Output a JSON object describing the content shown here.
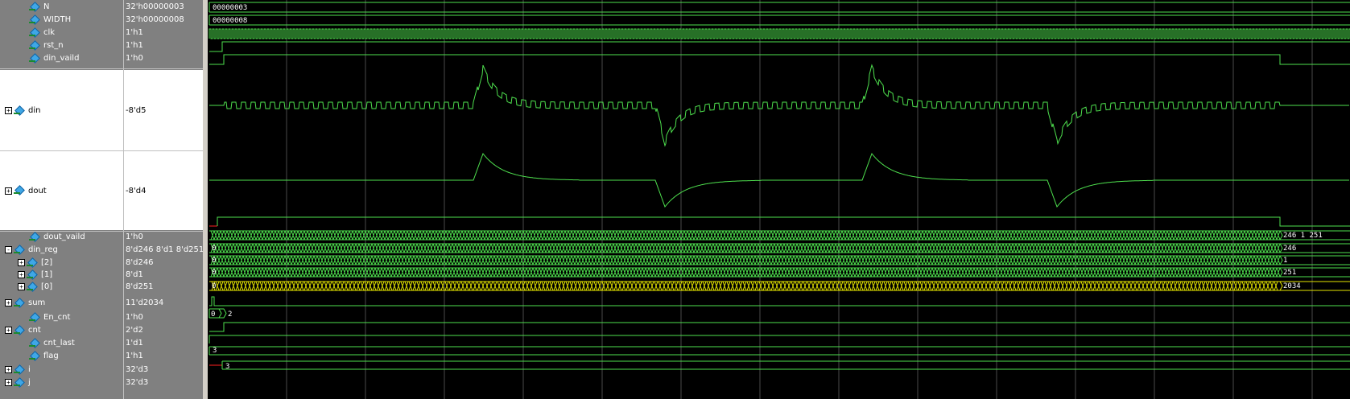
{
  "signals": [
    {
      "name": "N",
      "value": "32'h00000003",
      "indent": 1,
      "expand": "",
      "wave_label": "00000003"
    },
    {
      "name": "WIDTH",
      "value": "32'h00000008",
      "indent": 1,
      "expand": "",
      "wave_label": "00000008"
    },
    {
      "name": "clk",
      "value": "1'h1",
      "indent": 1,
      "expand": "",
      "wave_label": ""
    },
    {
      "name": "rst_n",
      "value": "1'h1",
      "indent": 1,
      "expand": "",
      "wave_label": ""
    },
    {
      "name": "din_vaild",
      "value": "1'h0",
      "indent": 1,
      "expand": "",
      "wave_label": ""
    },
    {
      "name": "din",
      "value": "-8'd5",
      "indent": 0,
      "expand": "+",
      "wave_label": ""
    },
    {
      "name": "dout",
      "value": "-8'd4",
      "indent": 0,
      "expand": "+",
      "wave_label": ""
    },
    {
      "name": "dout_vaild",
      "value": "1'h0",
      "indent": 1,
      "expand": "",
      "wave_label": ""
    },
    {
      "name": "din_reg",
      "value": "8'd246 8'd1 8'd251",
      "indent": 0,
      "expand": "-",
      "wave_label": "246 1 251"
    },
    {
      "name": "[2]",
      "value": "8'd246",
      "indent": 2,
      "expand": "+",
      "wave_label": "246"
    },
    {
      "name": "[1]",
      "value": "8'd1",
      "indent": 2,
      "expand": "+",
      "wave_label": "1"
    },
    {
      "name": "[0]",
      "value": "8'd251",
      "indent": 2,
      "expand": "+",
      "wave_label": "251"
    },
    {
      "name": "sum",
      "value": "11'd2034",
      "indent": 0,
      "expand": "+",
      "wave_label": "2034"
    },
    {
      "name": "En_cnt",
      "value": "1'h0",
      "indent": 1,
      "expand": "",
      "wave_label": ""
    },
    {
      "name": "cnt",
      "value": "2'd2",
      "indent": 0,
      "expand": "+",
      "wave_label": "2"
    },
    {
      "name": "cnt_last",
      "value": "1'd1",
      "indent": 1,
      "expand": "",
      "wave_label": ""
    },
    {
      "name": "flag",
      "value": "1'h1",
      "indent": 1,
      "expand": "",
      "wave_label": ""
    },
    {
      "name": "i",
      "value": "32'd3",
      "indent": 0,
      "expand": "+",
      "wave_label": "3"
    },
    {
      "name": "j",
      "value": "32'd3",
      "indent": 0,
      "expand": "+",
      "wave_label": "3"
    }
  ],
  "wave_start_labels": {
    "zero": "0",
    "cnt_first": "0",
    "i_first": "3"
  },
  "colors": {
    "green": "#4ee04e",
    "yellow": "#e6e600",
    "red": "#ff2020",
    "grid": "#4a4a4a",
    "panel": "#808080",
    "white": "#ffffff"
  }
}
